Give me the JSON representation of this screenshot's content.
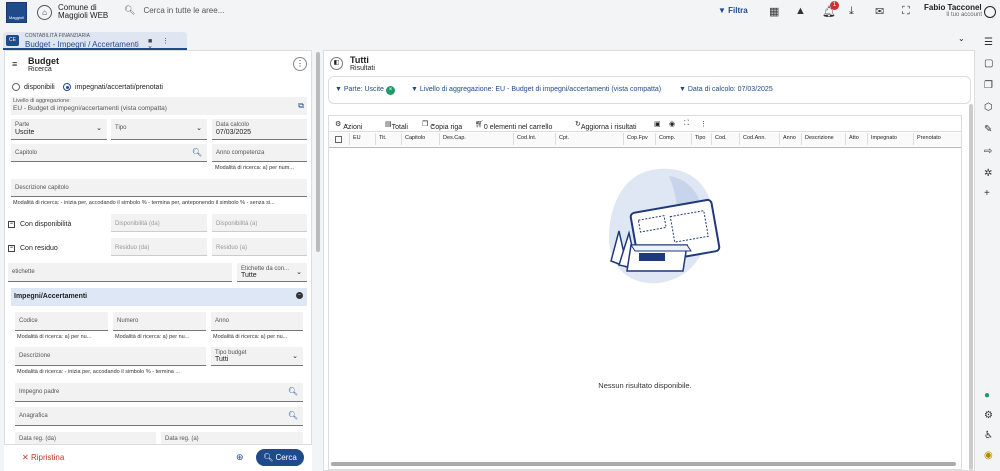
{
  "top": {
    "logo_caption": "Maggioli",
    "comune_line1": "Comune di",
    "comune_line2": "Maggioli WEB",
    "search_placeholder": "Cerca in tutte le aree...",
    "filter_label": "Filtra",
    "user_name": "Fabio Tacconell...",
    "user_sub": "Il tuo account",
    "notification_count": "1"
  },
  "tab": {
    "badge": "CE",
    "category": "CONTABILITÀ FINANZIARIA",
    "title": "Budget - Impegni / Accertamenti",
    "actions": "■ ⋮ ×"
  },
  "left": {
    "title": "Budget",
    "subtitle": "Ricerca",
    "radio_disponibili": "disponibili",
    "radio_impegnati": "impegnati/accertati/prenotati",
    "livello_label": "Livello di aggregazione:",
    "livello_value": "EU - Budget di impegni/accertamenti (vista compatta)",
    "parte_label": "Parte",
    "parte_value": "Uscite",
    "tipo_label": "Tipo",
    "data_calcolo_label": "Data calcolo",
    "data_calcolo_value": "07/03/2025",
    "capitolo_label": "Capitolo",
    "anno_competenza_label": "Anno competenza",
    "anno_hint": "Modalità di ricerca: a) per num...",
    "descrizione_capitolo_label": "Descrizione capitolo",
    "descrizione_hint": "Modalità di ricerca: - inizia per, accodando il simbolo % - termina per, anteponendo il simbolo % - senza si...",
    "con_disponibilita": "Con disponibilità",
    "disp_da": "Disponibilità (da)",
    "disp_a": "Disponibilità (a)",
    "con_residuo": "Con residuo",
    "residuo_da": "Residuo (da)",
    "residuo_a": "Residuo (a)",
    "etichette": "etichette",
    "etichette_con_label": "Etichette da con...",
    "etichette_con_value": "Tutte",
    "section_title": "Impegni/Accertamenti",
    "codice_label": "Codice",
    "numero_label": "Numero",
    "anno_label": "Anno",
    "hint_short": "Modalità di ricerca: a) per nu...",
    "descrizione_label": "Descrizione",
    "tipo_budget_label": "Tipo budget",
    "tipo_budget_value": "Tutti",
    "desc2_hint": "Modalità di ricerca: - inizia per, accodando il simbolo % - termina ...",
    "impegno_padre_label": "Impegno padre",
    "anagrafica_label": "Anagrafica",
    "data_reg_da": "Data reg. (da)",
    "data_reg_a": "Data reg. (a)",
    "ripristina": "Ripristina",
    "cerca": "Cerca"
  },
  "right": {
    "title": "Tutti",
    "subtitle": "Risultati",
    "chips": [
      "Parte: Uscite",
      "Livello di aggregazione: EU - Budget di impegni/accertamenti (vista compatta)",
      "Data di calcolo: 07/03/2025"
    ],
    "toolbar": {
      "azioni": "Azioni",
      "totali": "Totali",
      "copia_riga": "Copia riga",
      "carrello": "0 elementi nel carrello",
      "aggiorna": "Aggiorna i risultati"
    },
    "columns": [
      "EU",
      "Tit.",
      "Capitolo",
      "Des.Cap.",
      "Cod.Int.",
      "Cpt.",
      "Cop.Fpv",
      "Comp.",
      "Tipo",
      "Cod.",
      "Cod.Ann.",
      "Anno",
      "Descrizione",
      "Atto",
      "Impegnato",
      "Prenotato"
    ],
    "empty_message": "Nessun risultato disponibile."
  }
}
